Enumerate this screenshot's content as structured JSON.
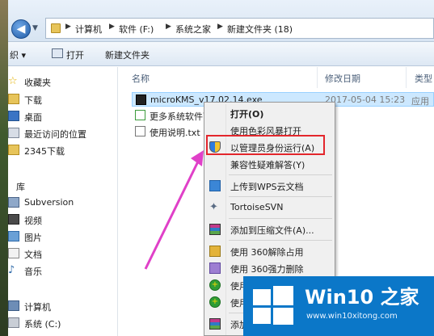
{
  "address": {
    "crumbs": [
      "计算机",
      "软件 (F:)",
      "系统之家",
      "新建文件夹 (18)"
    ]
  },
  "toolbar": {
    "organize": "织 ▾",
    "open": "打开",
    "new_folder": "新建文件夹"
  },
  "nav": {
    "favorites_label": "收藏夹",
    "favorites": [
      "下载",
      "桌面",
      "最近访问的位置",
      "2345下载"
    ],
    "libraries_label": "库",
    "libraries": [
      "Subversion",
      "视频",
      "图片",
      "文档",
      "音乐"
    ],
    "computer_label": "计算机",
    "drive": "系统 (C:)"
  },
  "columns": {
    "name": "名称",
    "modified": "修改日期",
    "type": "类型"
  },
  "files": [
    {
      "name": "microKMS_v17.02.14.exe",
      "date": "2017-05-04 15:23",
      "type": "应用"
    },
    {
      "name": "更多系统软件下",
      "date": "",
      "type": ""
    },
    {
      "name": "使用说明.txt",
      "date": "",
      "type": ""
    }
  ],
  "context_menu": {
    "open": "打开(O)",
    "color_style_open": "使用色彩风暴打开",
    "run_as_admin": "以管理员身份运行(A)",
    "compat_troubleshoot": "兼容性疑难解答(Y)",
    "upload_wps": "上传到WPS云文档",
    "tortoise_svn": "TortoiseSVN",
    "add_to_archive": "添加到压缩文件(A)...",
    "unlock_360": "使用 360解除占用",
    "force_delete_360": "使用 360强力删除",
    "use_a": "使用",
    "use_b": "使用",
    "add_partial": "添加"
  },
  "watermark": {
    "title": "Win10 之家",
    "url": "www.win10xitong.com"
  },
  "colors": {
    "highlight_box": "#e3262c",
    "arrow": "#e040c8",
    "watermark_bg": "#0b77c8"
  }
}
